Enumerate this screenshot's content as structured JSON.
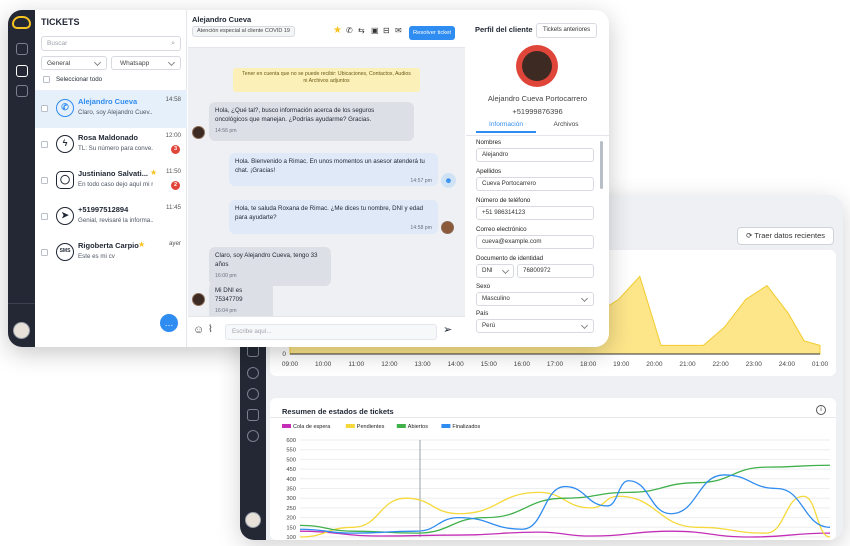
{
  "tickets": {
    "title": "TICKETS",
    "search_placeholder": "Buscar",
    "filter_status": "General",
    "filter_channel": "Whatsapp",
    "select_all": "Seleccionar todo",
    "items": [
      {
        "name": "Alejandro Cueva",
        "preview": "Claro, soy Alejandro Cuev...",
        "time": "14:58",
        "icon": "whatsapp-icon",
        "badge": ""
      },
      {
        "name": "Rosa Maldonado",
        "preview": "TL: Su número para conve...",
        "time": "12:00",
        "icon": "messenger-icon",
        "badge": "3"
      },
      {
        "name": "Justiniano Salvati...",
        "preview": "En todo caso dejo aquí mi n...",
        "time": "11:50",
        "icon": "instagram-icon",
        "badge": "2"
      },
      {
        "name": "+51997512894",
        "preview": "Genial, revisaré la informa...",
        "time": "11:45",
        "icon": "telegram-icon",
        "badge": ""
      },
      {
        "name": "Rigoberta Carpio",
        "preview": "Este es mi cv",
        "time": "ayer",
        "icon": "sms-icon",
        "badge": ""
      }
    ]
  },
  "chat": {
    "contact_name": "Alejandro Cueva",
    "tag": "Atención especial al cliente COVID 19",
    "resolve_label": "Resolver ticket",
    "notice": "Tener en cuenta que no se puede recibir: Ubicaciones, Contactos, Audios ni Archivos adjuntos",
    "messages": [
      {
        "side": "left",
        "text": "Hola, ¿Qué tal?, busco información acerca de los seguros oncológicos que manejan. ¿Podrías ayudarme? Gracias.",
        "time": "14:56 pm"
      },
      {
        "side": "right",
        "text": "Hola. Bienvenido a Rimac. En unos momentos un asesor atenderá tu chat. ¡Gracias!",
        "time": "14:57 pm"
      },
      {
        "side": "right",
        "text": "Hola, te saluda Roxana de Rimac. ¿Me dices tu nombre, DNI y edad para ayudarte?",
        "time": "14:58 pm"
      },
      {
        "side": "left",
        "text": "Claro, soy Alejandro Cueva, tengo 33 años",
        "time": "16:00 pm"
      },
      {
        "side": "left",
        "text": "Mi DNI es 75347709",
        "time": "16:04 pm"
      }
    ],
    "input_placeholder": "Escribe aquí..."
  },
  "profile": {
    "title": "Perfil del cliente",
    "prev_tickets": "Tickets anteriores",
    "full_name": "Alejandro Cueva Portocarrero",
    "phone_display": "+51999876396",
    "tab_info": "Información",
    "tab_files": "Archivos",
    "fields": {
      "nombres_label": "Nombres",
      "nombres": "Alejandro",
      "apellidos_label": "Apellidos",
      "apellidos": "Cueva Portocarrero",
      "telefono_label": "Número de teléfono",
      "telefono": "+51 986314123",
      "correo_label": "Correo electrónico",
      "correo": "cueva@example.com",
      "doc_label": "Documento de identidad",
      "doc_type": "DNI",
      "doc_number": "76800972",
      "sexo_label": "Sexo",
      "sexo": "Masculino",
      "pais_label": "País",
      "pais": "Perú"
    }
  },
  "dashboard": {
    "refresh_label": "Traer datos recientes",
    "status_title": "Resumen de estados de tickets"
  },
  "chart_data": [
    {
      "type": "area",
      "x": [
        "09:00",
        "10:00",
        "11:00",
        "12:00",
        "13:00",
        "14:00",
        "15:00",
        "16:00",
        "17:00",
        "18:00",
        "19:00",
        "20:00",
        "21:00",
        "22:00",
        "23:00",
        "24:00",
        "01:00"
      ],
      "y_ticks": [
        "0"
      ],
      "color": "#fde58a"
    },
    {
      "type": "line",
      "title": "Resumen de estados de tickets",
      "ylim": [
        100,
        600
      ],
      "y_ticks": [
        "100",
        "150",
        "200",
        "250",
        "300",
        "350",
        "400",
        "450",
        "500",
        "550",
        "600"
      ],
      "series": [
        {
          "name": "Cola de espera",
          "color": "#c42fb7"
        },
        {
          "name": "Pendientes",
          "color": "#f5d93a"
        },
        {
          "name": "Abiertos",
          "color": "#3fb04a"
        },
        {
          "name": "Finalizados",
          "color": "#2f8cf0"
        }
      ]
    }
  ]
}
